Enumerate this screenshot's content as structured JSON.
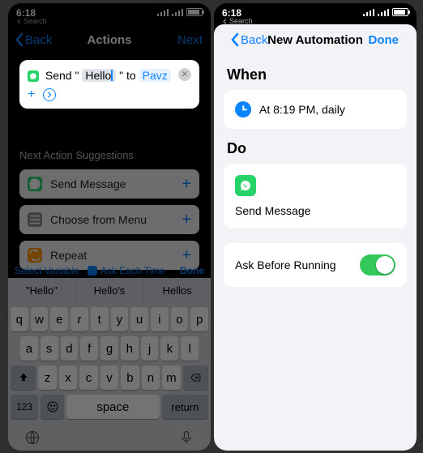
{
  "status": {
    "time": "6:18",
    "search": "Search"
  },
  "left": {
    "nav": {
      "back": "Back",
      "title": "Actions",
      "next": "Next"
    },
    "action": {
      "prefix": "Send",
      "openQuote": "\"",
      "message": "Hello",
      "closeQuote": "\"",
      "to": "to",
      "recipient": "Pavz"
    },
    "suggestionsTitle": "Next Action Suggestions",
    "suggestions": [
      {
        "label": "Send Message"
      },
      {
        "label": "Choose from Menu"
      },
      {
        "label": "Repeat"
      }
    ],
    "varbar": {
      "selectVariable": "Select Variable",
      "askEachTime": "Ask Each Time",
      "done": "Done"
    },
    "kbSuggest": [
      "\"Hello\"",
      "Hello's",
      "Hellos"
    ],
    "kbRows": {
      "r1": [
        "q",
        "w",
        "e",
        "r",
        "t",
        "y",
        "u",
        "i",
        "o",
        "p"
      ],
      "r2": [
        "a",
        "s",
        "d",
        "f",
        "g",
        "h",
        "j",
        "k",
        "l"
      ],
      "r3": [
        "z",
        "x",
        "c",
        "v",
        "b",
        "n",
        "m"
      ]
    },
    "kbLabels": {
      "num": "123",
      "space": "space",
      "ret": "return"
    }
  },
  "right": {
    "nav": {
      "back": "Back",
      "title": "New Automation",
      "done": "Done"
    },
    "whenTitle": "When",
    "whenText": "At 8:19 PM, daily",
    "doTitle": "Do",
    "doActionLabel": "Send Message",
    "askBefore": "Ask Before Running"
  }
}
